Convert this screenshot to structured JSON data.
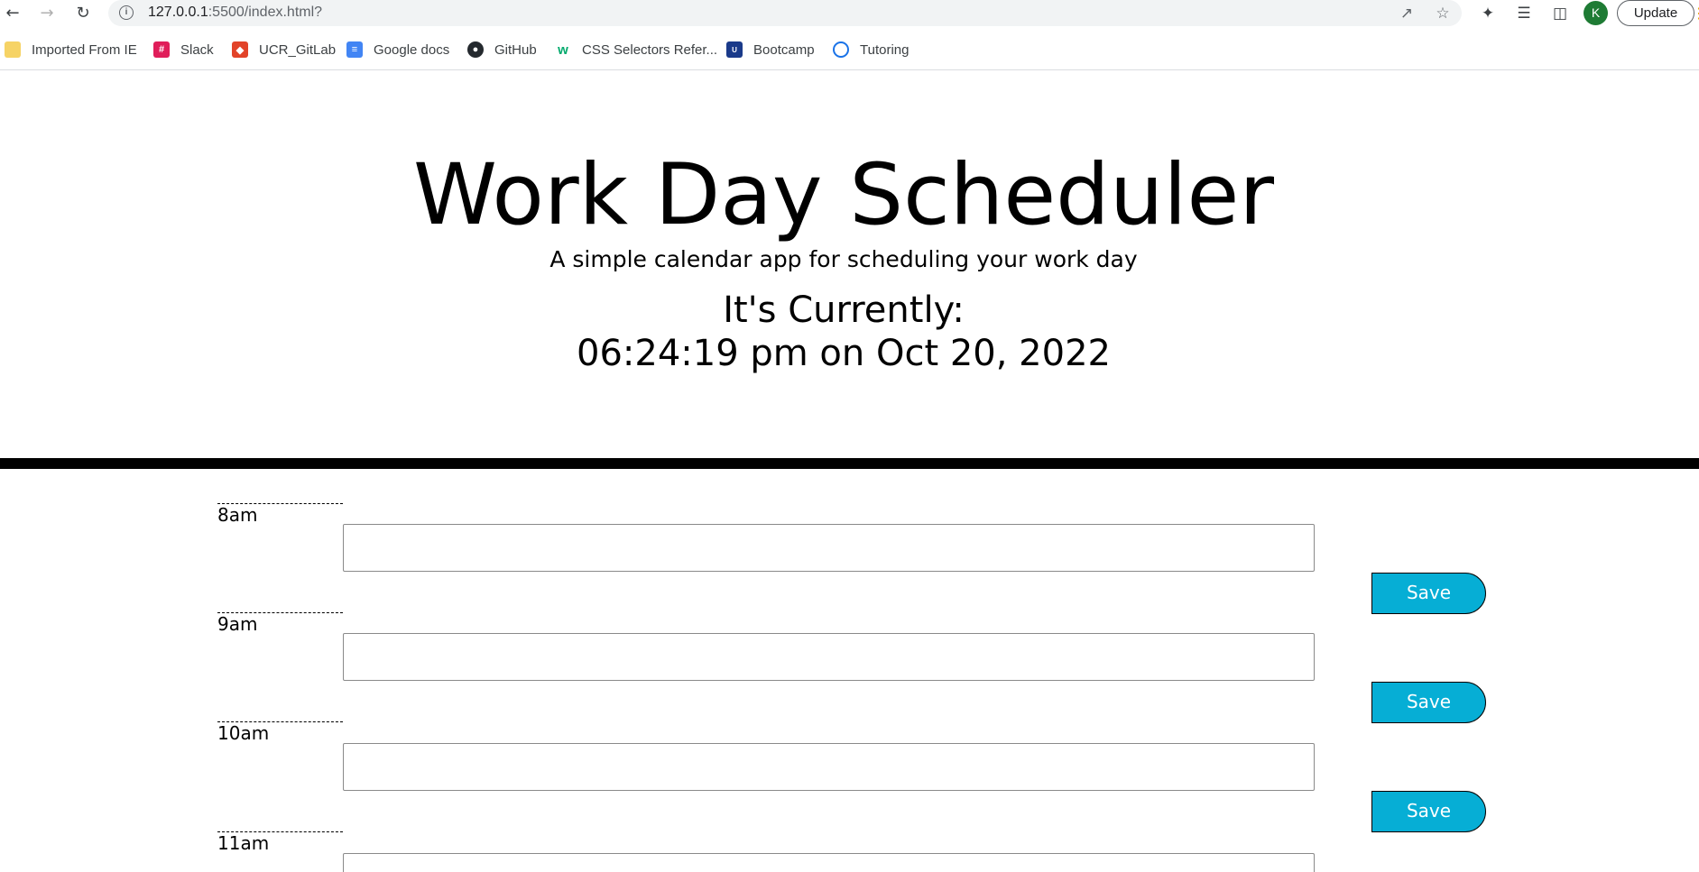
{
  "browser": {
    "url_host": "127.0.0.1",
    "url_rest": ":5500/index.html?",
    "avatar_letter": "K",
    "update_label": "Update",
    "bookmarks": [
      {
        "label": "Imported From IE",
        "icon": "folder-icon",
        "color": "#f6d365"
      },
      {
        "label": "Slack",
        "icon": "slack-icon",
        "color": "#4a154b"
      },
      {
        "label": "UCR_GitLab",
        "icon": "gitlab-icon",
        "color": "#e24329"
      },
      {
        "label": "Google docs",
        "icon": "google-docs-icon",
        "color": "#4285f4"
      },
      {
        "label": "GitHub",
        "icon": "github-icon",
        "color": "#24292e"
      },
      {
        "label": "CSS Selectors Refer...",
        "icon": "w3schools-icon",
        "color": "#04aa6d"
      },
      {
        "label": "Bootcamp",
        "icon": "bootcamp-icon",
        "color": "#1a3a8a"
      },
      {
        "label": "Tutoring",
        "icon": "tutoring-icon",
        "color": "#1a73e8"
      }
    ]
  },
  "header": {
    "title": "Work Day Scheduler",
    "lead": "A simple calendar app for scheduling your work day",
    "current_label": "It's Currently:",
    "current_time": "06:24:19 pm on Oct 20, 2022"
  },
  "schedule": {
    "save_label": "Save",
    "rows": [
      {
        "hour": "8am",
        "value": ""
      },
      {
        "hour": "9am",
        "value": ""
      },
      {
        "hour": "10am",
        "value": ""
      },
      {
        "hour": "11am",
        "value": ""
      }
    ]
  },
  "colors": {
    "save_button": "#06aed5"
  }
}
